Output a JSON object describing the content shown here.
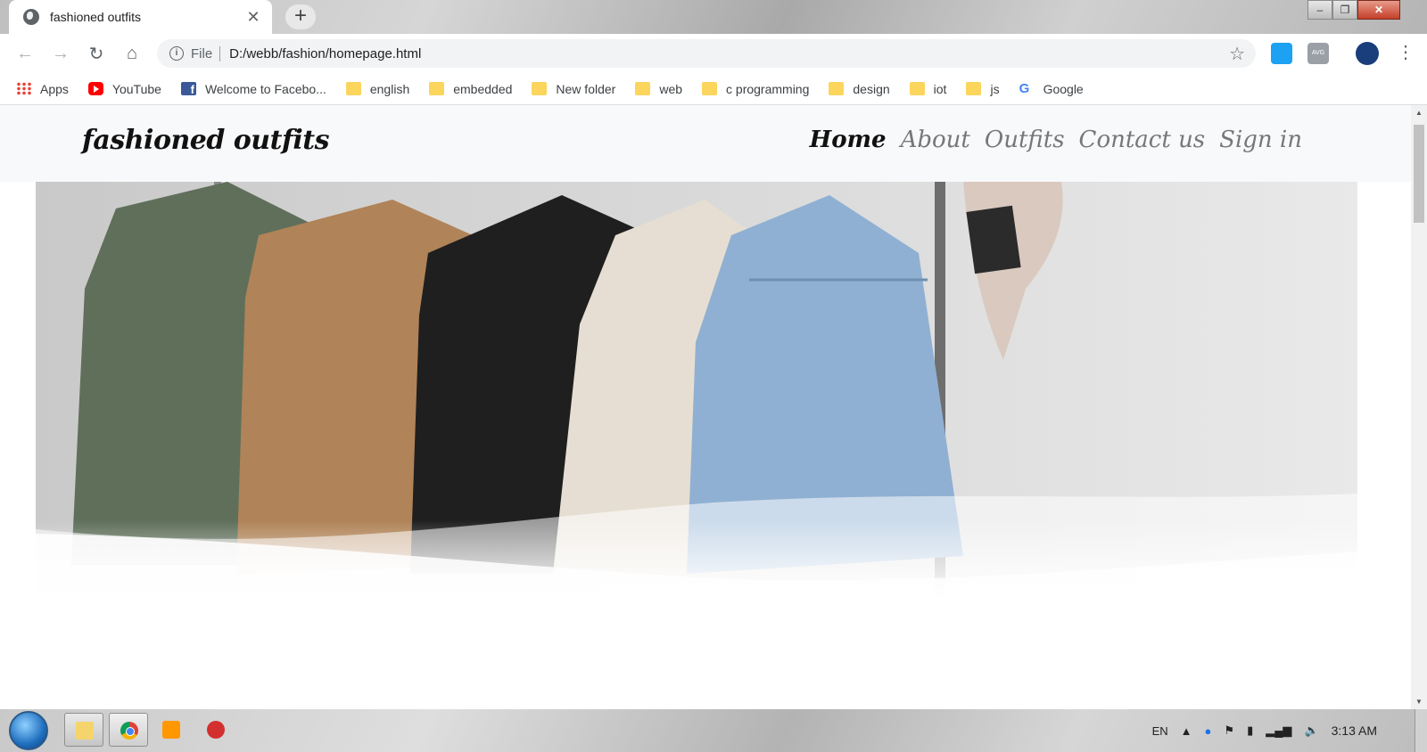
{
  "browser": {
    "tab_title": "fashioned outfits",
    "tab_close": "✕",
    "new_tab": "+",
    "window_controls": [
      "‒",
      "❐",
      "✕"
    ],
    "nav": {
      "back": "←",
      "forward": "→",
      "reload": "↻",
      "home": "⌂"
    },
    "address": {
      "info": "i",
      "scheme": "File",
      "url": "D:/webb/fashion/homepage.html"
    },
    "star": "☆",
    "menu": "⋮",
    "ext2_label": "AVG"
  },
  "bookmarks": [
    {
      "label": "Apps",
      "icon": "apps-icon"
    },
    {
      "label": "YouTube",
      "icon": "youtube-icon"
    },
    {
      "label": "Welcome to Facebo...",
      "icon": "facebook-icon"
    },
    {
      "label": "english",
      "icon": "folder-icon"
    },
    {
      "label": "embedded",
      "icon": "folder-icon"
    },
    {
      "label": "New folder",
      "icon": "folder-icon"
    },
    {
      "label": "web",
      "icon": "folder-icon"
    },
    {
      "label": "c programming",
      "icon": "folder-icon"
    },
    {
      "label": "design",
      "icon": "folder-icon"
    },
    {
      "label": "iot",
      "icon": "folder-icon"
    },
    {
      "label": "js",
      "icon": "folder-icon"
    },
    {
      "label": "Google",
      "icon": "google-icon"
    }
  ],
  "site": {
    "brand": "fashioned outfits",
    "nav": [
      "Home",
      "About",
      "Outfits",
      "Contact us",
      "Sign in"
    ],
    "active_nav": "Home"
  },
  "taskbar": {
    "lang": "EN",
    "clock": "3:13 AM"
  },
  "colors": {
    "jacket_green": "#5f6f5a",
    "jacket_tan": "#b08358",
    "jacket_black": "#1f1f1f",
    "sweater_cream": "#e6ded2",
    "denim": "#8fb0d2",
    "hat": "#d9c9bf"
  }
}
